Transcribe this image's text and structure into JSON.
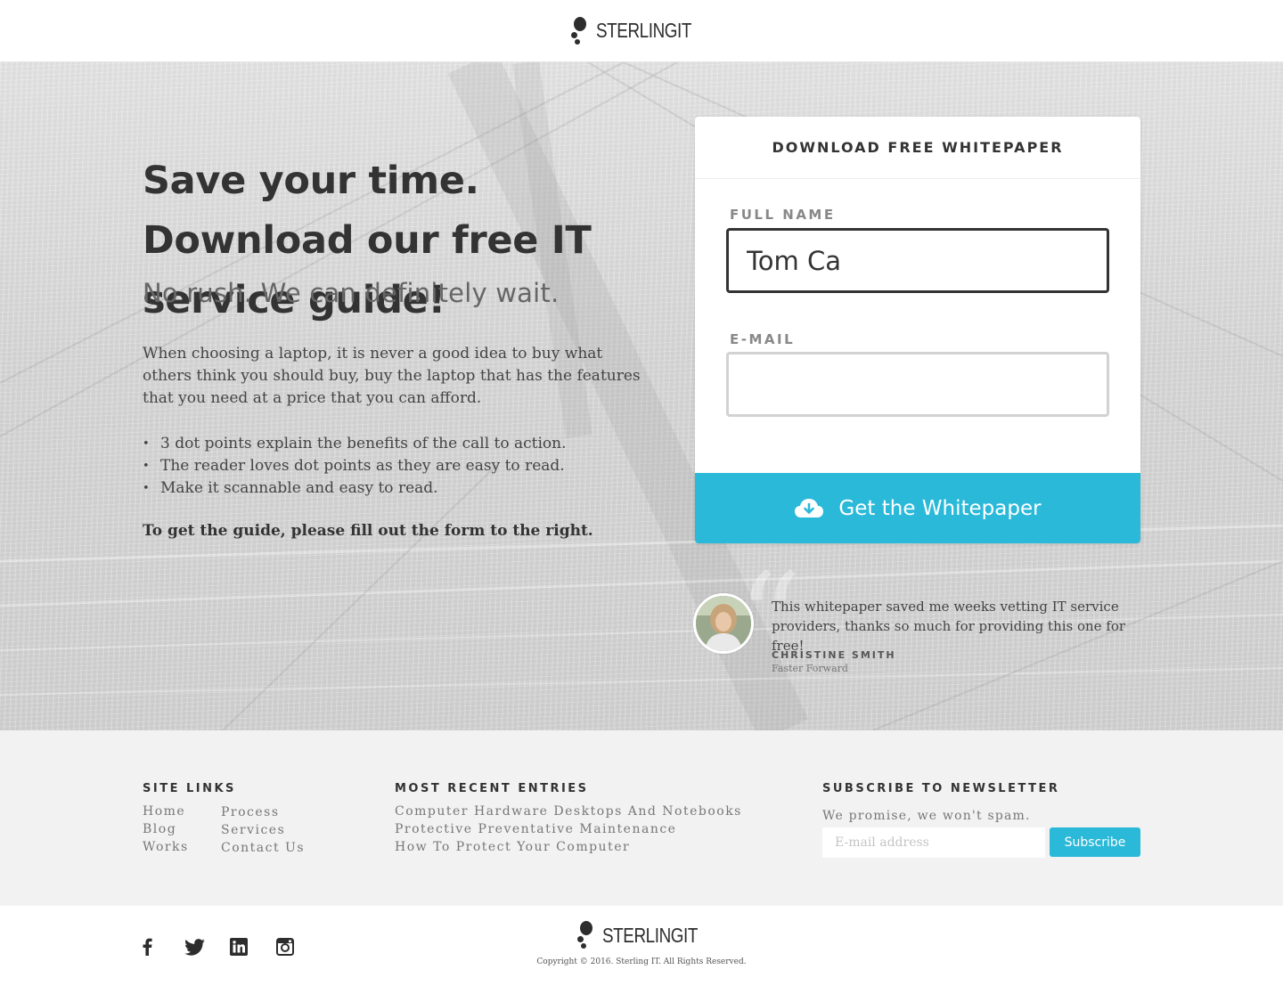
{
  "header": {
    "logo_text": "STERLINGIT"
  },
  "hero": {
    "heading": "Save your time. Download our free IT service guide!",
    "subheading": "No rush. We can definitely wait.",
    "body": "When choosing a laptop, it is never a good idea to buy what others think you should buy, buy the laptop that has the features that you need at a price that you can afford.",
    "bullets": [
      "3 dot points explain the benefits of the call to action.",
      "The reader loves dot points as they are easy to read.",
      "Make it scannable and easy to read."
    ],
    "cta_note": "To get the guide, please fill out the form to the right."
  },
  "form": {
    "title": "DOWNLOAD FREE WHITEPAPER",
    "name_label": "FULL NAME",
    "name_value": "Tom Ca",
    "email_label": "E-MAIL",
    "email_value": "",
    "button_label": "Get the Whitepaper",
    "button_icon": "cloud-download-icon",
    "accent_color": "#2bb9d9"
  },
  "testimonial": {
    "quote": "This whitepaper saved me weeks vetting IT service providers, thanks so much for providing this one for free!",
    "name": "CHRISTINE SMITH",
    "company": "Faster Forward"
  },
  "footer": {
    "site_links_title": "SITE LINKS",
    "site_links": [
      "Home",
      "Blog",
      "Works",
      "Process",
      "Services",
      "Contact Us"
    ],
    "recent_title": "MOST RECENT ENTRIES",
    "recent_entries": [
      "Computer Hardware Desktops And Notebooks",
      "Protective Preventative Maintenance",
      "How To Protect Your Computer"
    ],
    "newsletter_title": "SUBSCRIBE TO NEWSLETTER",
    "newsletter_text": "We promise, we won't spam.",
    "newsletter_placeholder": "E-mail address",
    "subscribe_label": "Subscribe"
  },
  "bottom": {
    "logo_text": "STERLINGIT",
    "social": [
      "facebook-icon",
      "twitter-icon",
      "linkedin-icon",
      "instagram-icon"
    ],
    "copyright": "Copyright © 2016.  Sterling IT.  All Rights Reserved."
  }
}
